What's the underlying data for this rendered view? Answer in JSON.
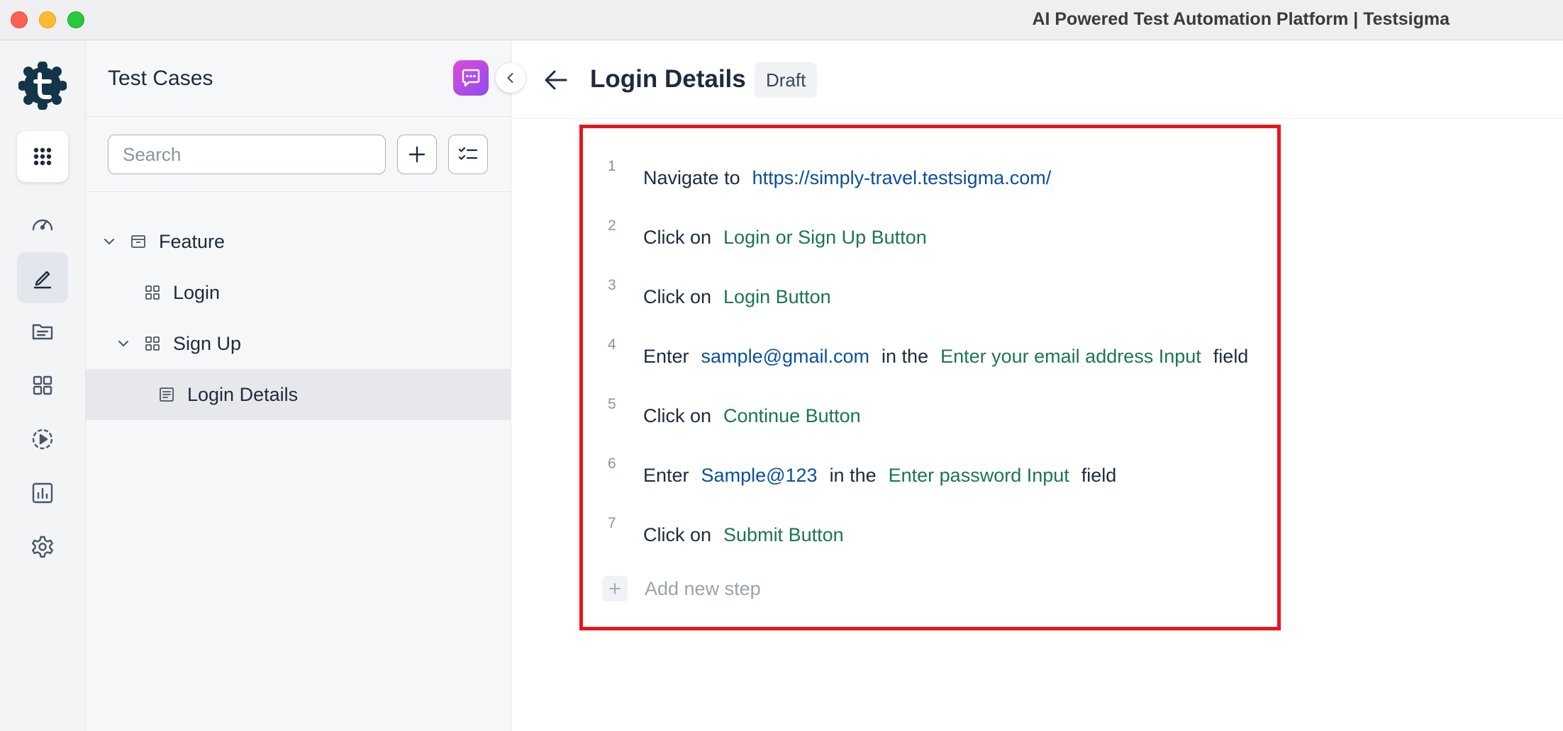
{
  "window": {
    "title": "AI Powered Test Automation Platform | Testsigma"
  },
  "rail": {
    "items": [
      {
        "name": "apps-grid-icon"
      },
      {
        "name": "dashboard-icon"
      },
      {
        "name": "test-cases-icon",
        "active": true
      },
      {
        "name": "test-data-icon"
      },
      {
        "name": "elements-icon"
      },
      {
        "name": "runs-icon"
      },
      {
        "name": "reports-icon"
      },
      {
        "name": "settings-icon"
      }
    ]
  },
  "panel": {
    "title": "Test Cases",
    "search_placeholder": "Search",
    "tree": [
      {
        "label": "Feature",
        "type": "feature",
        "expanded": true
      },
      {
        "label": "Login",
        "type": "requirement"
      },
      {
        "label": "Sign Up",
        "type": "requirement",
        "expanded": true
      },
      {
        "label": "Login Details",
        "type": "test-case",
        "selected": true
      }
    ]
  },
  "main": {
    "title": "Login Details",
    "status": "Draft",
    "steps": [
      {
        "num": "1",
        "parts": [
          {
            "t": "kw",
            "v": "Navigate to"
          },
          {
            "t": "tdata",
            "v": "https://simply-travel.testsigma.com/"
          }
        ]
      },
      {
        "num": "2",
        "parts": [
          {
            "t": "kw",
            "v": "Click on"
          },
          {
            "t": "elem",
            "v": "Login or Sign Up Button"
          }
        ]
      },
      {
        "num": "3",
        "parts": [
          {
            "t": "kw",
            "v": "Click on"
          },
          {
            "t": "elem",
            "v": "Login Button"
          }
        ]
      },
      {
        "num": "4",
        "parts": [
          {
            "t": "kw",
            "v": "Enter"
          },
          {
            "t": "tdata",
            "v": "sample@gmail.com"
          },
          {
            "t": "kw",
            "v": "in the"
          },
          {
            "t": "elem",
            "v": "Enter your email address Input"
          },
          {
            "t": "kw",
            "v": "field"
          }
        ]
      },
      {
        "num": "5",
        "parts": [
          {
            "t": "kw",
            "v": "Click on"
          },
          {
            "t": "elem",
            "v": "Continue Button"
          }
        ]
      },
      {
        "num": "6",
        "parts": [
          {
            "t": "kw",
            "v": "Enter"
          },
          {
            "t": "tdata",
            "v": "Sample@123"
          },
          {
            "t": "kw",
            "v": "in the"
          },
          {
            "t": "elem",
            "v": "Enter password Input"
          },
          {
            "t": "kw",
            "v": "field"
          }
        ]
      },
      {
        "num": "7",
        "parts": [
          {
            "t": "kw",
            "v": "Click on"
          },
          {
            "t": "elem",
            "v": "Submit Button"
          }
        ]
      }
    ],
    "add_step_label": "Add new step"
  },
  "colors": {
    "highlight": "#e8161c",
    "test_data": "#0b4f9c",
    "element": "#1b7650",
    "brand_dark": "#14344a"
  }
}
